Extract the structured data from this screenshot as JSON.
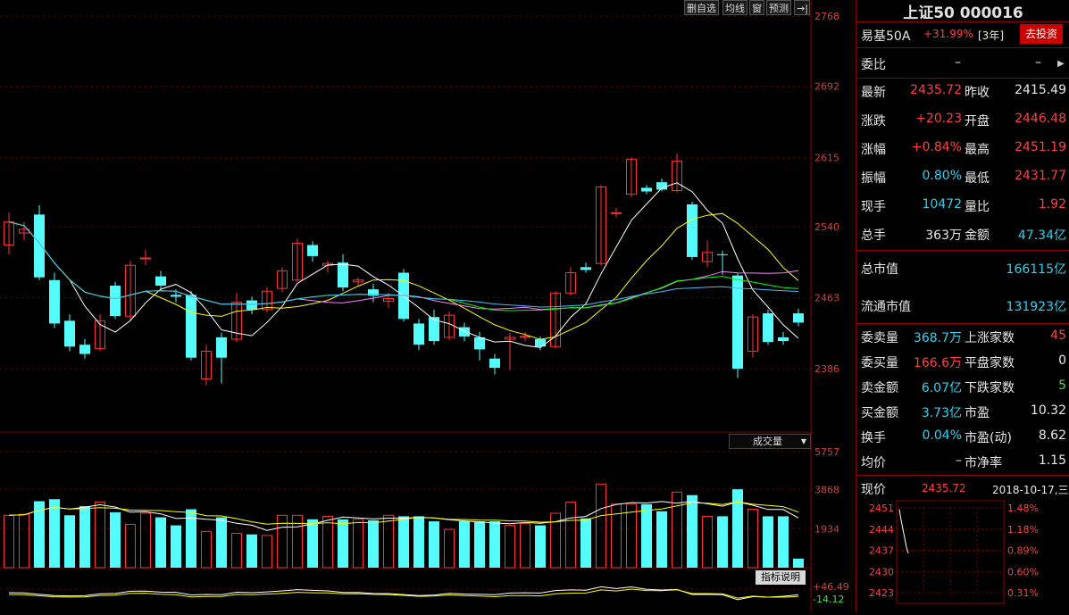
{
  "toolbar": {
    "items": [
      "删自选",
      "均线",
      "窗",
      "预测"
    ],
    "exit_icon": "exit-right-icon"
  },
  "price_axis": {
    "ticks": [
      "2768",
      "2692",
      "2615",
      "2540",
      "2463",
      "2386"
    ]
  },
  "volume": {
    "selector_label": "成交量",
    "axis_ticks": [
      "5757",
      "3868",
      "1934"
    ]
  },
  "indicator": {
    "button_label": "指标说明",
    "top_value": "+46.49",
    "bottom_value": "-14.12"
  },
  "colors": {
    "up": "#ff3232",
    "down": "#54fcfc",
    "ma5": "#ffffff",
    "ma10": "#ffff00",
    "ma20": "#ff80ff",
    "ma30": "#00ff00",
    "ma60": "#40c0ff",
    "panel_border": "#8b0000"
  },
  "chart_data": {
    "type": "candlestick",
    "ylim": [
      2360,
      2768
    ],
    "volume_ylim": [
      0,
      5757
    ],
    "candles": [
      {
        "o": 2520,
        "c": 2545,
        "h": 2555,
        "l": 2510,
        "v": 2600
      },
      {
        "o": 2533,
        "c": 2537,
        "h": 2545,
        "l": 2525,
        "v": 2650
      },
      {
        "o": 2553,
        "c": 2485,
        "h": 2563,
        "l": 2482,
        "v": 3300
      },
      {
        "o": 2482,
        "c": 2435,
        "h": 2490,
        "l": 2430,
        "v": 3400
      },
      {
        "o": 2438,
        "c": 2410,
        "h": 2445,
        "l": 2405,
        "v": 2600
      },
      {
        "o": 2412,
        "c": 2402,
        "h": 2418,
        "l": 2397,
        "v": 3050
      },
      {
        "o": 2408,
        "c": 2438,
        "h": 2445,
        "l": 2405,
        "v": 3250
      },
      {
        "o": 2476,
        "c": 2443,
        "h": 2480,
        "l": 2440,
        "v": 2750
      },
      {
        "o": 2443,
        "c": 2498,
        "h": 2503,
        "l": 2438,
        "v": 2150
      },
      {
        "o": 2505,
        "c": 2506,
        "h": 2515,
        "l": 2498,
        "v": 2700
      },
      {
        "o": 2486,
        "c": 2476,
        "h": 2492,
        "l": 2470,
        "v": 2500
      },
      {
        "o": 2466,
        "c": 2464,
        "h": 2472,
        "l": 2458,
        "v": 2100
      },
      {
        "o": 2466,
        "c": 2398,
        "h": 2470,
        "l": 2395,
        "v": 2900
      },
      {
        "o": 2375,
        "c": 2405,
        "h": 2412,
        "l": 2368,
        "v": 1800
      },
      {
        "o": 2420,
        "c": 2398,
        "h": 2425,
        "l": 2370,
        "v": 2500
      },
      {
        "o": 2418,
        "c": 2458,
        "h": 2468,
        "l": 2415,
        "v": 1700
      },
      {
        "o": 2460,
        "c": 2450,
        "h": 2464,
        "l": 2445,
        "v": 1650
      },
      {
        "o": 2450,
        "c": 2470,
        "h": 2474,
        "l": 2447,
        "v": 1600
      },
      {
        "o": 2473,
        "c": 2492,
        "h": 2496,
        "l": 2469,
        "v": 2600
      },
      {
        "o": 2482,
        "c": 2522,
        "h": 2527,
        "l": 2480,
        "v": 2600
      },
      {
        "o": 2520,
        "c": 2508,
        "h": 2524,
        "l": 2502,
        "v": 2400
      },
      {
        "o": 2498,
        "c": 2500,
        "h": 2503,
        "l": 2490,
        "v": 2550
      },
      {
        "o": 2501,
        "c": 2474,
        "h": 2510,
        "l": 2470,
        "v": 2400
      },
      {
        "o": 2480,
        "c": 2482,
        "h": 2485,
        "l": 2475,
        "v": 2400
      },
      {
        "o": 2472,
        "c": 2465,
        "h": 2478,
        "l": 2458,
        "v": 2350
      },
      {
        "o": 2459,
        "c": 2462,
        "h": 2468,
        "l": 2452,
        "v": 2600
      },
      {
        "o": 2490,
        "c": 2440,
        "h": 2494,
        "l": 2437,
        "v": 2550
      },
      {
        "o": 2435,
        "c": 2412,
        "h": 2440,
        "l": 2406,
        "v": 2550
      },
      {
        "o": 2442,
        "c": 2416,
        "h": 2450,
        "l": 2412,
        "v": 2300
      },
      {
        "o": 2420,
        "c": 2444,
        "h": 2448,
        "l": 2417,
        "v": 1900
      },
      {
        "o": 2431,
        "c": 2421,
        "h": 2436,
        "l": 2416,
        "v": 2300
      },
      {
        "o": 2420,
        "c": 2407,
        "h": 2426,
        "l": 2395,
        "v": 2300
      },
      {
        "o": 2397,
        "c": 2387,
        "h": 2402,
        "l": 2380,
        "v": 2300
      },
      {
        "o": 2418,
        "c": 2420,
        "h": 2425,
        "l": 2385,
        "v": 2100
      },
      {
        "o": 2421,
        "c": 2421,
        "h": 2426,
        "l": 2416,
        "v": 2200
      },
      {
        "o": 2418,
        "c": 2410,
        "h": 2421,
        "l": 2406,
        "v": 2100
      },
      {
        "o": 2410,
        "c": 2468,
        "h": 2470,
        "l": 2408,
        "v": 2700
      },
      {
        "o": 2468,
        "c": 2490,
        "h": 2496,
        "l": 2465,
        "v": 3250
      },
      {
        "o": 2496,
        "c": 2493,
        "h": 2501,
        "l": 2490,
        "v": 2450
      },
      {
        "o": 2500,
        "c": 2583,
        "h": 2585,
        "l": 2498,
        "v": 4150
      },
      {
        "o": 2555,
        "c": 2555,
        "h": 2560,
        "l": 2550,
        "v": 3150
      },
      {
        "o": 2575,
        "c": 2613,
        "h": 2615,
        "l": 2572,
        "v": 3150
      },
      {
        "o": 2582,
        "c": 2578,
        "h": 2585,
        "l": 2575,
        "v": 3150
      },
      {
        "o": 2588,
        "c": 2580,
        "h": 2592,
        "l": 2578,
        "v": 2800
      },
      {
        "o": 2579,
        "c": 2611,
        "h": 2619,
        "l": 2577,
        "v": 3750
      },
      {
        "o": 2564,
        "c": 2507,
        "h": 2567,
        "l": 2504,
        "v": 3600
      },
      {
        "o": 2502,
        "c": 2512,
        "h": 2525,
        "l": 2496,
        "v": 2550
      },
      {
        "o": 2510,
        "c": 2509,
        "h": 2514,
        "l": 2488,
        "v": 2550
      },
      {
        "o": 2487,
        "c": 2386,
        "h": 2490,
        "l": 2376,
        "v": 3890
      },
      {
        "o": 2405,
        "c": 2442,
        "h": 2445,
        "l": 2398,
        "v": 2900
      },
      {
        "o": 2446,
        "c": 2415,
        "h": 2450,
        "l": 2412,
        "v": 2550
      },
      {
        "o": 2420,
        "c": 2416,
        "h": 2426,
        "l": 2412,
        "v": 2550
      },
      {
        "o": 2446,
        "c": 2436,
        "h": 2451,
        "l": 2432,
        "v": 450
      }
    ]
  },
  "quote": {
    "title": "上证50 000016",
    "fund_name": "易基50A",
    "fund_return": "+31.99%",
    "fund_period": "[3年]",
    "invest_button": "去投资",
    "weibi_label": "委比",
    "weibi_value": "–",
    "weicha_value": "–",
    "rows": [
      {
        "l1": "最新",
        "v1": "2435.72",
        "c1": "red",
        "l2": "昨收",
        "v2": "2415.49",
        "c2": "white"
      },
      {
        "l1": "涨跌",
        "v1": "+20.23",
        "c1": "red",
        "l2": "开盘",
        "v2": "2446.48",
        "c2": "red"
      },
      {
        "l1": "涨幅",
        "v1": "+0.84%",
        "c1": "red",
        "l2": "最高",
        "v2": "2451.19",
        "c2": "red"
      },
      {
        "l1": "振幅",
        "v1": "0.80%",
        "c1": "cyan",
        "l2": "最低",
        "v2": "2431.77",
        "c2": "red"
      },
      {
        "l1": "现手",
        "v1": "10472",
        "c1": "cyan",
        "l2": "量比",
        "v2": "1.92",
        "c2": "red"
      },
      {
        "l1": "总手",
        "v1": "363万",
        "c1": "white",
        "l2": "金额",
        "v2": "47.34亿",
        "c2": "cyan"
      }
    ],
    "market_cap_label": "总市值",
    "market_cap": "166115亿",
    "float_cap_label": "流通市值",
    "float_cap": "131923亿",
    "stats": [
      {
        "l1": "委卖量",
        "v1": "368.7万",
        "c1": "cyan",
        "l2": "上涨家数",
        "v2": "45",
        "c2": "red"
      },
      {
        "l1": "委买量",
        "v1": "166.6万",
        "c1": "red",
        "l2": "平盘家数",
        "v2": "0",
        "c2": "white"
      },
      {
        "l1": "卖金额",
        "v1": "6.07亿",
        "c1": "cyan",
        "l2": "下跌家数",
        "v2": "5",
        "c2": "green"
      },
      {
        "l1": "买金额",
        "v1": "3.73亿",
        "c1": "cyan",
        "l2": "市盈",
        "v2": "10.32",
        "c2": "white"
      },
      {
        "l1": "换手",
        "v1": "0.04%",
        "c1": "cyan",
        "l2": "市盈(动)",
        "v2": "8.62",
        "c2": "white"
      },
      {
        "l1": "均价",
        "v1": "–",
        "c1": "white",
        "l2": "市净率",
        "v2": "1.15",
        "c2": "white"
      }
    ],
    "intraday": {
      "label": "现价",
      "price": "2435.72",
      "date": "2018-10-17,三",
      "left_ticks": [
        "2451",
        "2444",
        "2437",
        "2430",
        "2423"
      ],
      "right_ticks": [
        "1.48%",
        "1.18%",
        "0.89%",
        "0.60%",
        "0.31%"
      ]
    }
  }
}
